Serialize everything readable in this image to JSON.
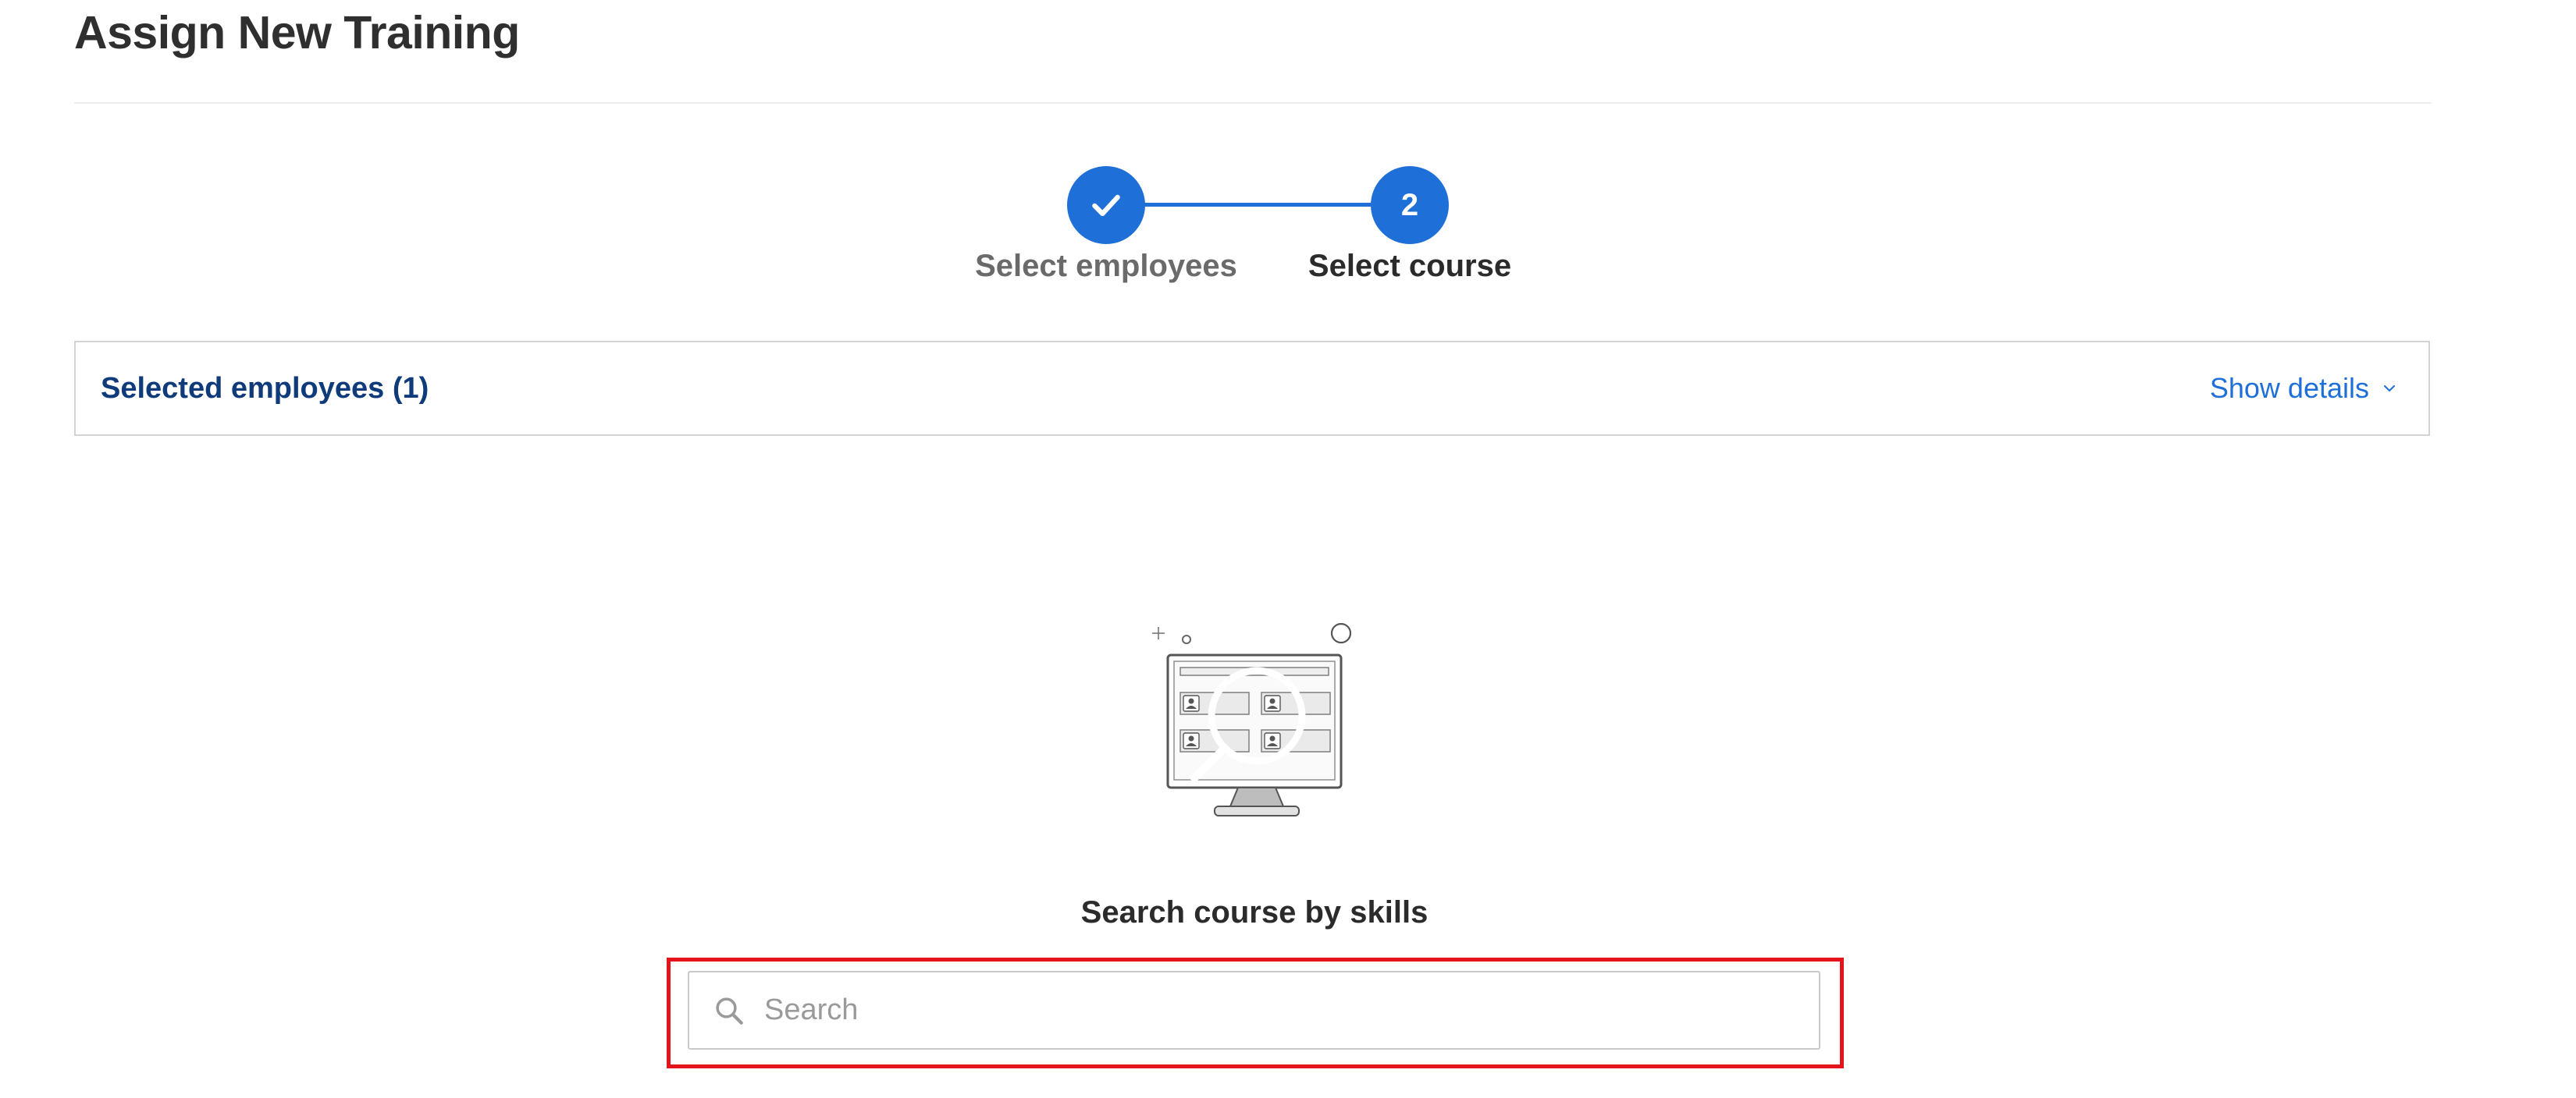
{
  "page": {
    "title": "Assign New Training"
  },
  "stepper": {
    "steps": [
      {
        "label": "Select employees",
        "state": "completed",
        "icon": "check-icon"
      },
      {
        "label": "Select course",
        "state": "active",
        "number": "2"
      }
    ],
    "accent_color": "#1f6fd8"
  },
  "selected_panel": {
    "title": "Selected employees (1)",
    "toggle_label": "Show details",
    "toggle_icon": "chevron-down-icon"
  },
  "search": {
    "heading": "Search course by skills",
    "placeholder": "Search",
    "value": "",
    "icon": "search-icon",
    "highlight_color": "#e3141b"
  },
  "illustration": {
    "icon": "monitor-search-illustration"
  }
}
